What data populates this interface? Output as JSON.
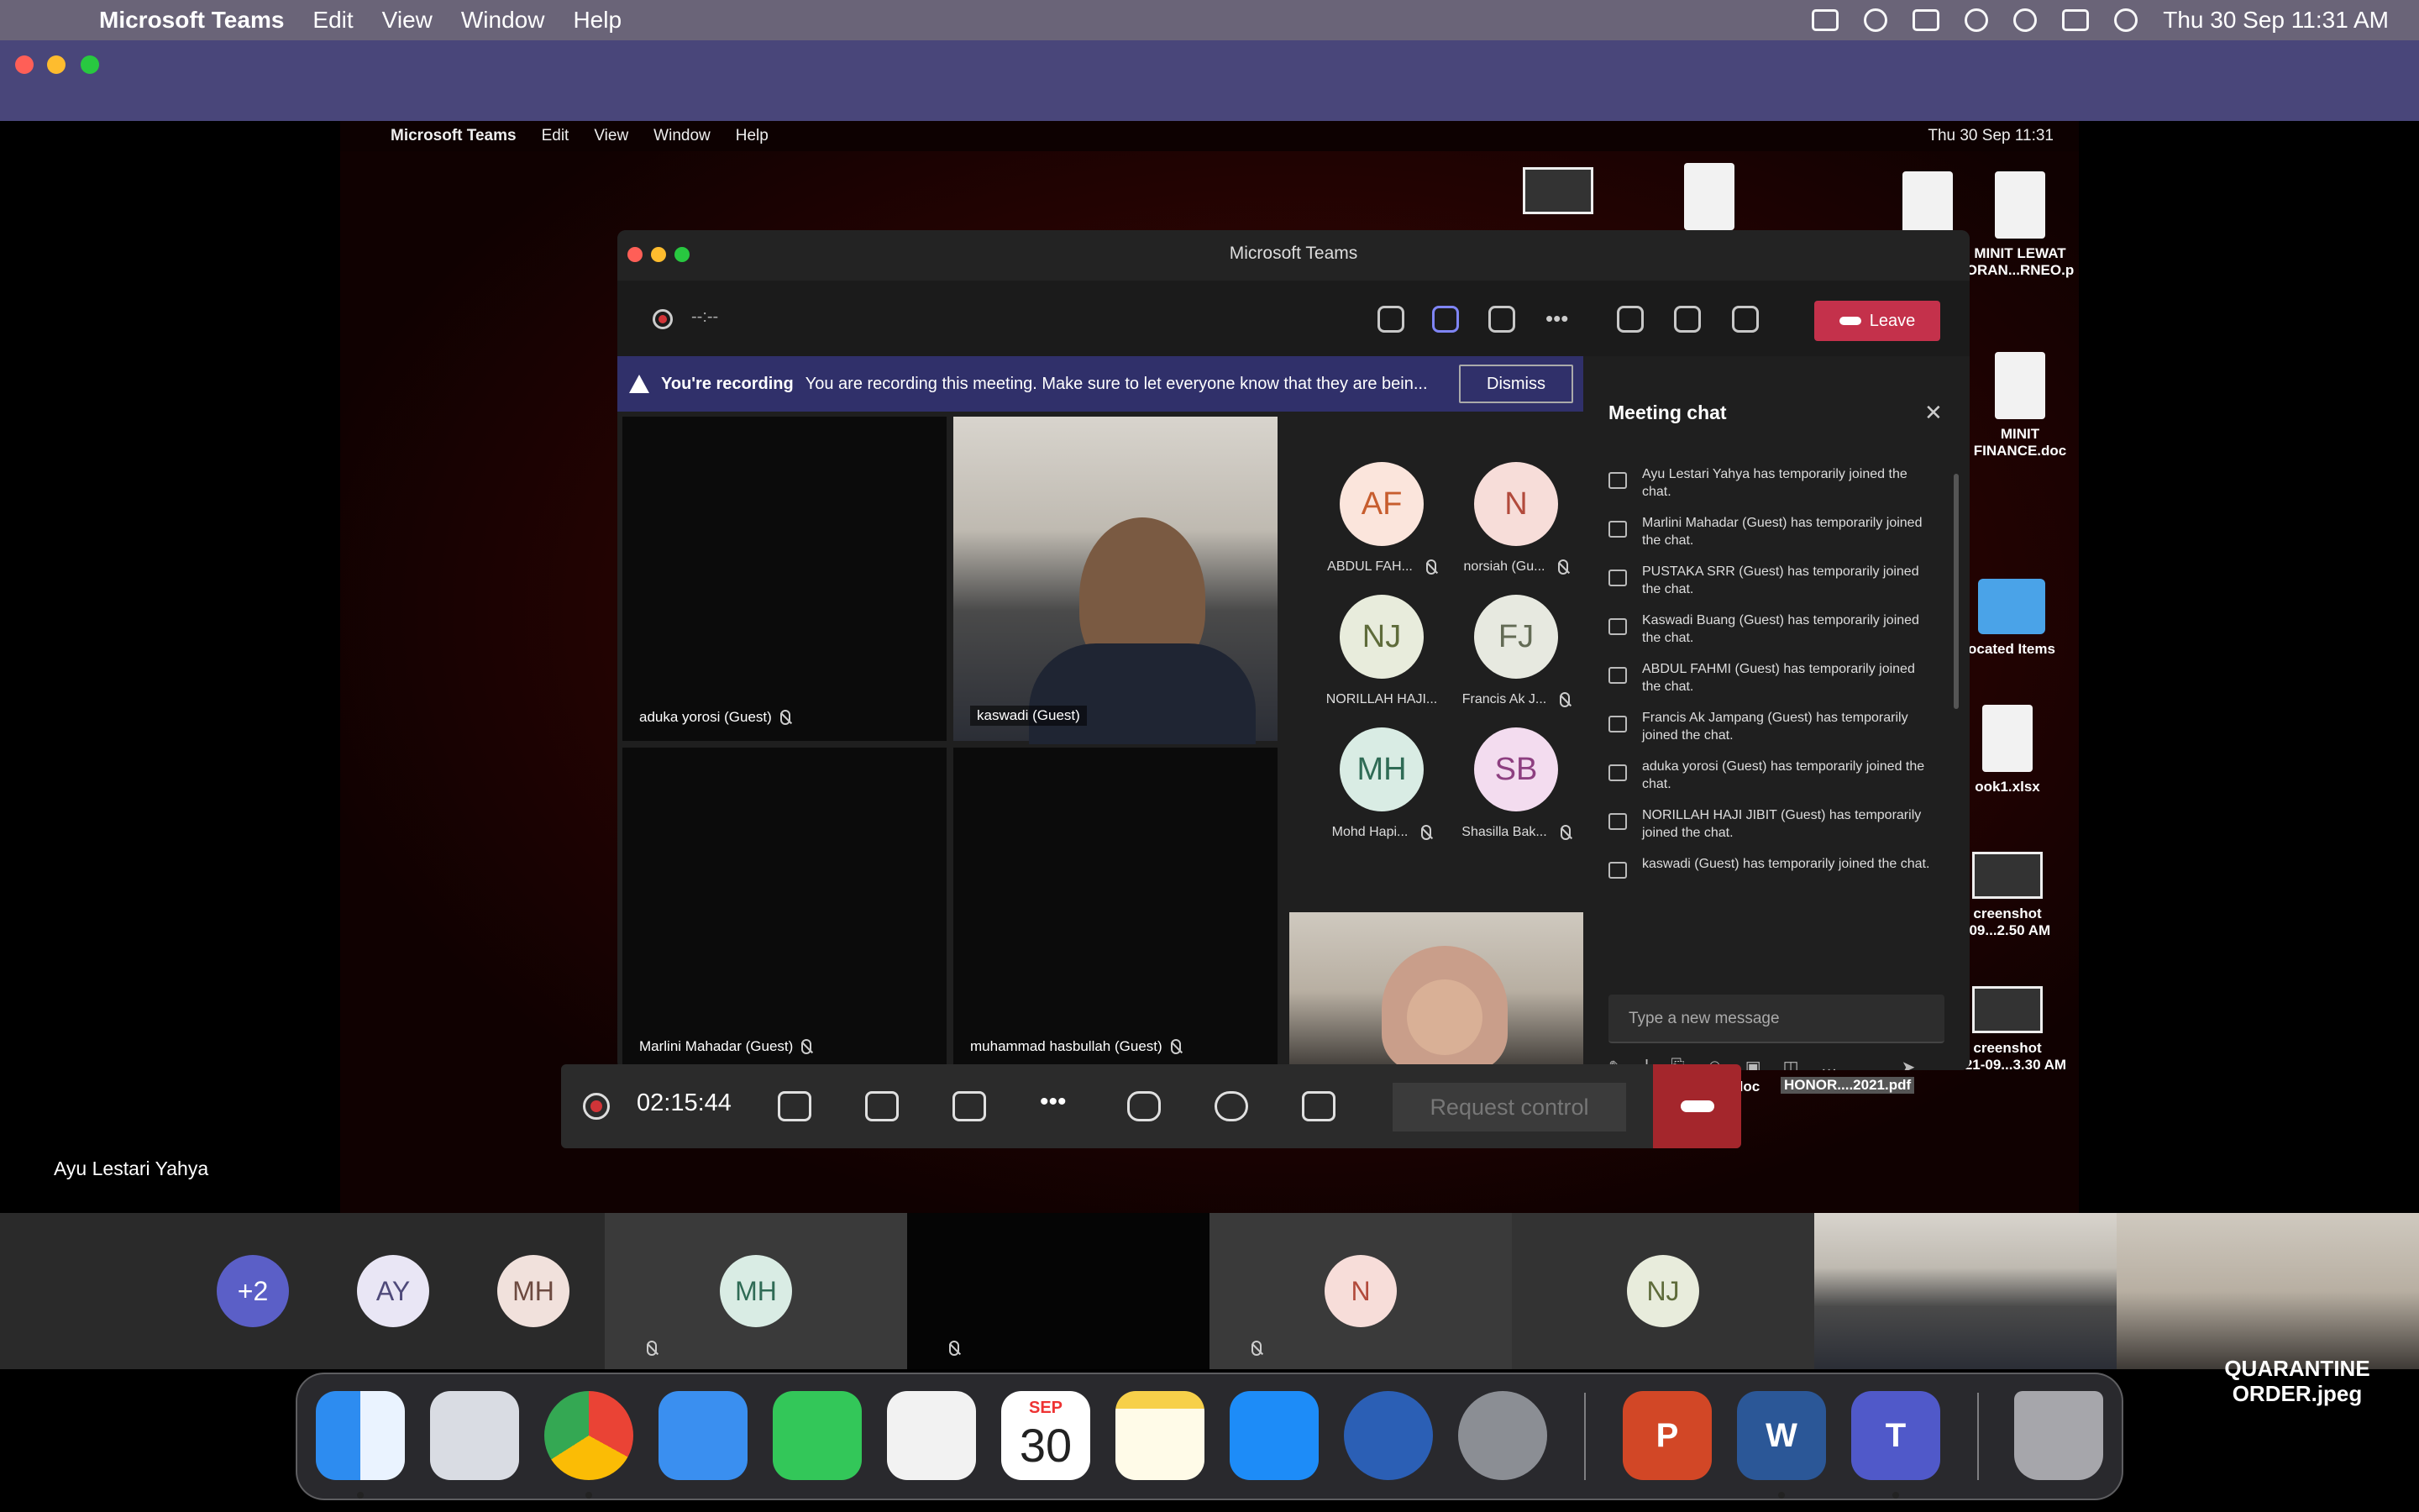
{
  "menubar": {
    "app": "Microsoft Teams",
    "items": [
      "Edit",
      "View",
      "Window",
      "Help"
    ],
    "clock": "Thu 30 Sep  11:31 AM"
  },
  "desktop": {
    "menubar": {
      "app": "Microsoft Teams",
      "items": [
        "Edit",
        "View",
        "Window",
        "Help"
      ],
      "clock": "Thu 30 Sep  11:31"
    },
    "files": [
      {
        "label": "MINIT LEWAT\nORAN...RNEO.p"
      },
      {
        "label": "MINIT\nFINANCE.doc"
      },
      {
        "label": "ocated Items"
      },
      {
        "label": "ook1.xlsx"
      },
      {
        "label": "creenshot\n-09...2.50 AM"
      },
      {
        "label": "creenshot\n2021-09...3.30 AM"
      }
    ],
    "doc_label": "doc",
    "honor_label": "HONOR....2021.pdf"
  },
  "teams": {
    "title": "Microsoft Teams",
    "timer_placeholder": "--:--",
    "leave": "Leave",
    "banner": {
      "title": "You're recording",
      "message": "You are recording this meeting. Make sure to let everyone know that they are bein...",
      "dismiss": "Dismiss"
    },
    "tiles": [
      {
        "name": "aduka yorosi (Guest)"
      },
      {
        "name": "kaswadi (Guest)"
      },
      {
        "name": "Marlini Mahadar (Guest)"
      },
      {
        "name": "muhammad hasbullah (Guest)"
      }
    ],
    "avatars": [
      {
        "initials": "AF",
        "name": "ABDUL FAH...",
        "bg": "#fbe5dc",
        "fg": "#c75d2e"
      },
      {
        "initials": "N",
        "name": "norsiah (Gu...",
        "bg": "#f7ddd9",
        "fg": "#b24a3c"
      },
      {
        "initials": "NJ",
        "name": "NORILLAH HAJI...",
        "bg": "#e8ecdc",
        "fg": "#5e6b3a"
      },
      {
        "initials": "FJ",
        "name": "Francis Ak J...",
        "bg": "#e7e9e0",
        "fg": "#636b55"
      },
      {
        "initials": "MH",
        "name": "Mohd Hapi...",
        "bg": "#d9ece4",
        "fg": "#2f6b55"
      },
      {
        "initials": "SB",
        "name": "Shasilla Bak...",
        "bg": "#f3dcef",
        "fg": "#8d3f80"
      }
    ],
    "chat": {
      "title": "Meeting chat",
      "messages": [
        "Ayu Lestari Yahya has temporarily joined the chat.",
        "Marlini Mahadar (Guest) has temporarily joined the chat.",
        "PUSTAKA SRR (Guest) has temporarily joined the chat.",
        "Kaswadi Buang (Guest) has temporarily joined the chat.",
        "ABDUL FAHMI (Guest) has temporarily joined the chat.",
        "Francis Ak Jampang (Guest) has temporarily joined the chat.",
        "aduka yorosi (Guest) has temporarily joined the chat.",
        "NORILLAH HAJI JIBIT (Guest) has temporarily joined the chat.",
        "kaswadi (Guest) has temporarily joined the chat."
      ],
      "placeholder": "Type a new message"
    },
    "call_timer": "02:15:44",
    "request_control": "Request control"
  },
  "shared_by": "Ayu Lestari Yahya",
  "strip": [
    {
      "initials": "+2",
      "bg": "#5b5fc7",
      "fg": "#ffffff"
    },
    {
      "initials": "AY",
      "bg": "#e9e6f5",
      "fg": "#4f4a7a"
    },
    {
      "initials": "MH",
      "bg": "#f1e1dc",
      "fg": "#6d4a40"
    },
    {
      "initials": "MH",
      "bg": "#d9ece4",
      "fg": "#2f6b55"
    },
    {
      "initials": "N",
      "bg": "#f7ddd9",
      "fg": "#b24a3c"
    },
    {
      "initials": "NJ",
      "bg": "#e8ecdc",
      "fg": "#5e6b3a"
    }
  ],
  "dock": {
    "calendar_month": "SEP",
    "calendar_day": "30",
    "powerpoint": "P",
    "word": "W",
    "teams": "T"
  },
  "quarantine_label": "QUARANTINE\nORDER.jpeg"
}
